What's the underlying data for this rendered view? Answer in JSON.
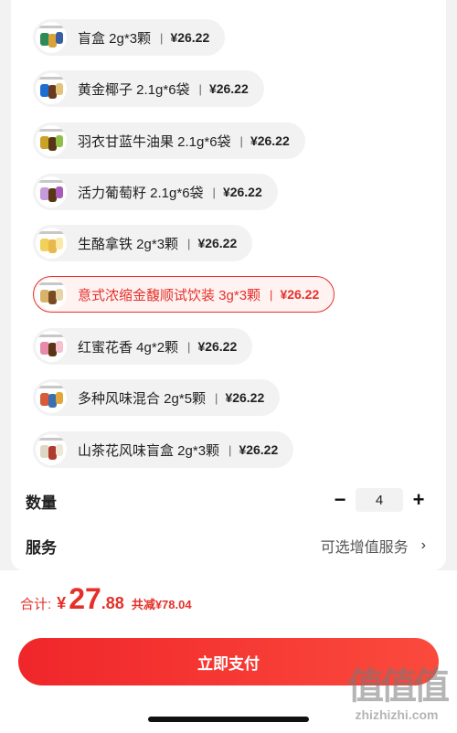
{
  "variants": [
    {
      "name": "盲盒 2g*3颗",
      "sep": "|",
      "price": "¥26.22",
      "selected": false,
      "colors": [
        "#2e8b57",
        "#d9a33a",
        "#3a5fa0"
      ]
    },
    {
      "name": "黄金椰子 2.1g*6袋",
      "sep": "|",
      "price": "¥26.22",
      "selected": false,
      "colors": [
        "#1c6fd1",
        "#6b3a1e",
        "#e3c27a"
      ]
    },
    {
      "name": "羽衣甘蓝牛油果 2.1g*6袋",
      "sep": "|",
      "price": "¥26.22",
      "selected": false,
      "colors": [
        "#c9a227",
        "#5a3515",
        "#8fbf45"
      ]
    },
    {
      "name": "活力葡萄籽 2.1g*6袋",
      "sep": "|",
      "price": "¥26.22",
      "selected": false,
      "colors": [
        "#c79ad9",
        "#5a3515",
        "#a85bb8"
      ]
    },
    {
      "name": "生酪拿铁 2g*3颗",
      "sep": "|",
      "price": "¥26.22",
      "selected": false,
      "colors": [
        "#f2d05a",
        "#e8b94a",
        "#fbe9a8"
      ]
    },
    {
      "name": "意式浓缩金馥顺试饮装 3g*3颗",
      "sep": "|",
      "price": "¥26.22",
      "selected": true,
      "colors": [
        "#d9b36b",
        "#7a4a22",
        "#e8d3a8"
      ]
    },
    {
      "name": "红蜜花香 4g*2颗",
      "sep": "|",
      "price": "¥26.22",
      "selected": false,
      "colors": [
        "#e88aa8",
        "#5a3515",
        "#f6c0cf"
      ]
    },
    {
      "name": "多种风味混合 2g*5颗",
      "sep": "|",
      "price": "¥26.22",
      "selected": false,
      "colors": [
        "#d85a3a",
        "#3a6fb0",
        "#e3a63a"
      ]
    },
    {
      "name": "山茶花风味盲盒 2g*3颗",
      "sep": "|",
      "price": "¥26.22",
      "selected": false,
      "colors": [
        "#e0d6c4",
        "#b03a2e",
        "#f0e6d6"
      ]
    }
  ],
  "quantity": {
    "label": "数量",
    "minus": "−",
    "value": "4",
    "plus": "+"
  },
  "service": {
    "label": "服务",
    "hint": "可选增值服务",
    "chevron": "›"
  },
  "total": {
    "label": "合计:",
    "currency": "¥",
    "integer": "27",
    "decimal": ".88",
    "discount": "共减¥78.04"
  },
  "pay_button": "立即支付",
  "watermark": {
    "logo": "值值值",
    "url": "zhizhizhi.com"
  },
  "colors": {
    "accent": "#e5302a",
    "chip_bg": "#f2f2f2",
    "card_bg": "#ffffff"
  }
}
